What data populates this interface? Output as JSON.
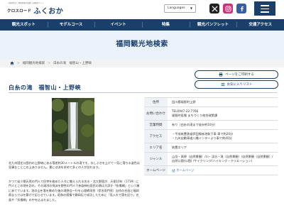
{
  "header": {
    "tagline": "一般財団法人 福岡県観光連盟 公式観光サイト",
    "brand_sub": "クロスロード",
    "brand_main": "ふくおか",
    "language_label": "Languages",
    "language_caret": "▼"
  },
  "nav": {
    "items": [
      {
        "label": "観光スポット"
      },
      {
        "label": "モデルコース"
      },
      {
        "label": "イベント"
      },
      {
        "label": "特集"
      },
      {
        "label": "観光パンフレット"
      },
      {
        "label": "交通アクセス"
      }
    ]
  },
  "banner": {
    "title": "福岡観光地検索"
  },
  "breadcrumb": {
    "items": [
      "福岡観光地検索",
      "白糸の滝　福智山・上野峡"
    ],
    "separator": ">"
  },
  "page": {
    "title": "白糸の滝　福智山・上野峡",
    "print_button": "ページをご印刷する",
    "list_button": "お気に入りリスト"
  },
  "description": {
    "p1": "北九州国定公園内の上野峡にある落差約30メートルの滝です。水しぶきを上げて一気に落ちる姿色は見事なことこの上ありません。夏には涼を求めて多くの人が訪れます。",
    "p2": "かつて幼少期天然の門人で民宰を務めた人々に敬えられる名水・北大野国が、天保10年（1739）に門人とこの地を訪れ、その清冽の飛沫を野性の門人で参詣神社居民の熱は大詳か「折傷網」という瀬にあてています。池の山を落を眺めた後の滝野会一行を心理師雨亮（伊名雨門亮）自作の名画と福岡県ならではを繋げて記らせています。昭和の感情で静岡伝で成功したために「見入れで落を記り」名画や「折傷網」の中を込まれました。"
  },
  "info": {
    "rows": [
      {
        "key": "住所",
        "values": [
          "田川郡福智町上野"
        ]
      },
      {
        "key": "お問い合わせ",
        "values": [
          "TEL0947-22-7766",
          "福智町役場 まちづくり総合政策課"
        ]
      },
      {
        "key": "営業時間",
        "values": [
          "有り（白糸の滝まで徒歩約10分）"
        ]
      },
      {
        "key": "アクセス",
        "values": [
          "・平成筑豊鉄道伊田線赤池駅下車 車で約20分",
          "・九州自動車道八幡インターより車で約40分"
        ]
      },
      {
        "key": "エリア名",
        "values": [
          "筑豊エリア"
        ]
      },
      {
        "key": "ジャンル",
        "values": [
          "山岳・高原（自然景観）/川・渓谷・滝（自然景観）/自然景観（自然景観）/自然公園(公園) /サイクリング/ハイキング・クリエーション)"
        ]
      },
      {
        "key": "ホームページ",
        "values": [
          "ホームページ"
        ]
      }
    ]
  },
  "colors": {
    "navy": "#1b3f6b",
    "banner_bg": "#eaf3fb",
    "table_key_bg": "#eef2f7"
  },
  "icons": [
    "x-logo-icon",
    "instagram-icon",
    "facebook-icon",
    "menu-icon",
    "home-icon",
    "printer-icon",
    "list-icon",
    "external-link-icon"
  ]
}
